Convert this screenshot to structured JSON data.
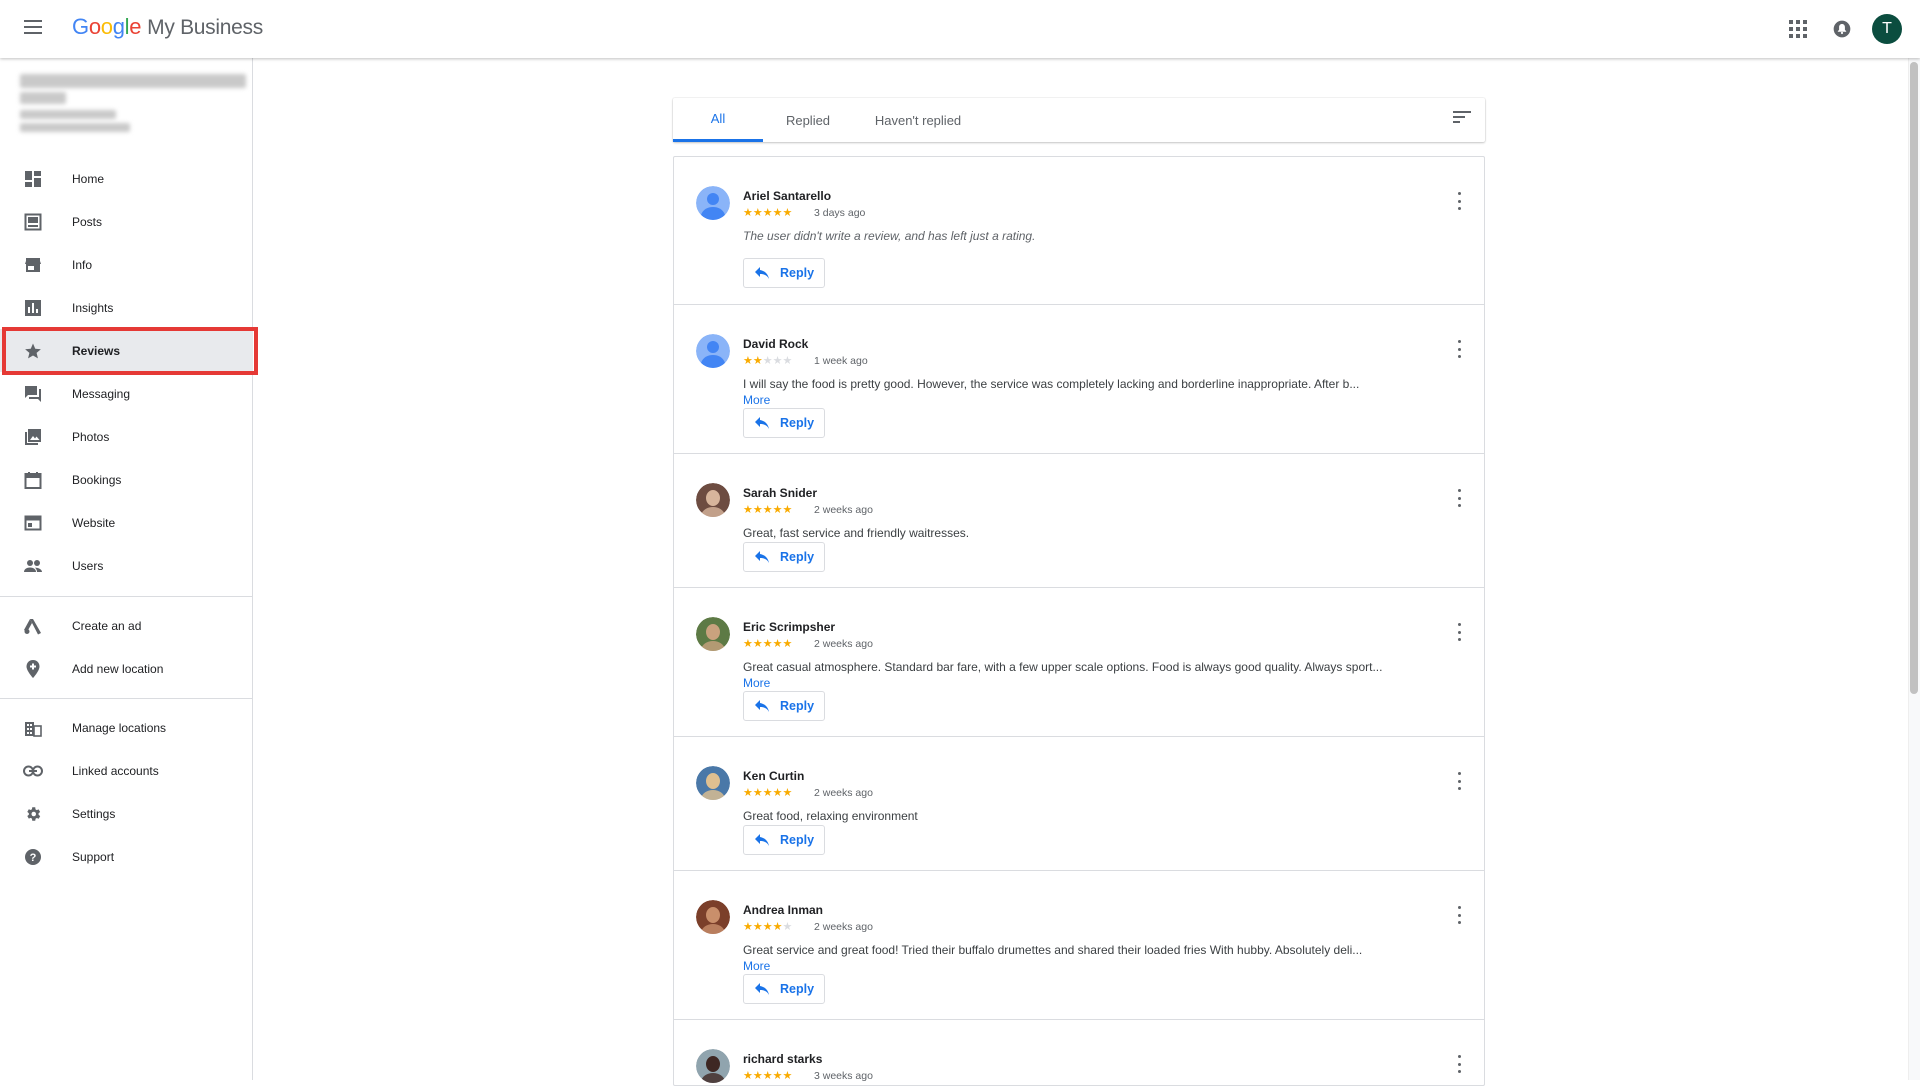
{
  "header": {
    "logo_g1": "G",
    "logo_o1": "o",
    "logo_o2": "o",
    "logo_g2": "g",
    "logo_l": "l",
    "logo_e": "e",
    "product": "My Business",
    "avatar_letter": "T"
  },
  "sidebar": {
    "items": [
      {
        "label": "Home",
        "icon": "dashboard-icon"
      },
      {
        "label": "Posts",
        "icon": "posts-icon"
      },
      {
        "label": "Info",
        "icon": "storefront-icon"
      },
      {
        "label": "Insights",
        "icon": "bar-chart-icon"
      },
      {
        "label": "Reviews",
        "icon": "star-icon"
      },
      {
        "label": "Messaging",
        "icon": "chat-icon"
      },
      {
        "label": "Photos",
        "icon": "photos-icon"
      },
      {
        "label": "Bookings",
        "icon": "calendar-icon"
      },
      {
        "label": "Website",
        "icon": "website-icon"
      },
      {
        "label": "Users",
        "icon": "users-icon"
      },
      {
        "label": "Create an ad",
        "icon": "google-ads-icon"
      },
      {
        "label": "Add new location",
        "icon": "location-pin-icon"
      },
      {
        "label": "Manage locations",
        "icon": "buildings-icon"
      },
      {
        "label": "Linked accounts",
        "icon": "link-icon"
      },
      {
        "label": "Settings",
        "icon": "gear-icon"
      },
      {
        "label": "Support",
        "icon": "help-icon"
      }
    ]
  },
  "tabs": [
    {
      "label": "All"
    },
    {
      "label": "Replied"
    },
    {
      "label": "Haven't replied"
    }
  ],
  "reviews": [
    {
      "name": "Ariel Santarello",
      "stars": 5,
      "time": "3 days ago",
      "text": "The user didn't write a review, and has left just a rating.",
      "more": ""
    },
    {
      "name": "David Rock",
      "stars": 2,
      "time": "1 week ago",
      "text": "I will say the food is pretty good. However, the service was completely lacking and borderline inappropriate. After b...",
      "more": "More"
    },
    {
      "name": "Sarah Snider",
      "stars": 5,
      "time": "2 weeks ago",
      "text": "Great, fast service and friendly waitresses.",
      "more": ""
    },
    {
      "name": "Eric Scrimpsher",
      "stars": 5,
      "time": "2 weeks ago",
      "text": "Great casual atmosphere. Standard bar fare, with a few upper scale options. Food is always good quality. Always sport...",
      "more": "More"
    },
    {
      "name": "Ken Curtin",
      "stars": 5,
      "time": "2 weeks ago",
      "text": "Great food, relaxing environment",
      "more": ""
    },
    {
      "name": "Andrea Inman",
      "stars": 4,
      "time": "2 weeks ago",
      "text": "Great service and great food! Tried their buffalo drumettes and shared their loaded fries With hubby. Absolutely deli...",
      "more": "More"
    },
    {
      "name": "richard starks",
      "stars": 5,
      "time": "3 weeks ago",
      "text": "",
      "more": ""
    }
  ],
  "reply_label": "Reply",
  "colors": {
    "accent": "#1a73e8",
    "star": "#f9ab00",
    "highlight": "#e53935"
  }
}
